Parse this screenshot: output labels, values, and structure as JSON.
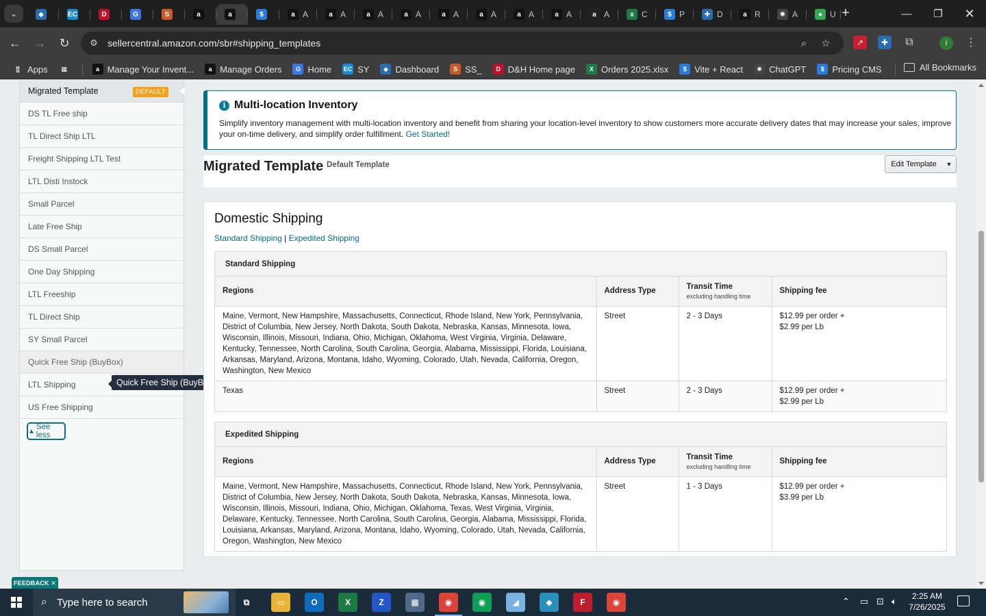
{
  "browser": {
    "tabs": [
      {
        "label": "",
        "icon": "blue-diamond",
        "color": "#2a6cb0",
        "glyph": "◆",
        "w": 46
      },
      {
        "label": "",
        "icon": "ec-logo",
        "color": "#1a8bd0",
        "glyph": "EC",
        "w": 46
      },
      {
        "label": "",
        "icon": "dh-logo",
        "color": "#c0102a",
        "glyph": "D",
        "w": 46
      },
      {
        "label": "",
        "icon": "g-docs",
        "color": "#3b78e7",
        "glyph": "G",
        "w": 46
      },
      {
        "label": "",
        "icon": "ss-logo",
        "color": "#c85a2a",
        "glyph": "S",
        "w": 46
      },
      {
        "label": "",
        "icon": "amazon-logo",
        "color": "#111111",
        "glyph": "a",
        "w": 46
      },
      {
        "label": "",
        "icon": "amazon-logo",
        "color": "#111111",
        "glyph": "a",
        "w": 46,
        "active": true
      },
      {
        "label": "",
        "icon": "dollar-logo",
        "color": "#2b7bd8",
        "glyph": "$",
        "w": 46
      },
      {
        "label": "A",
        "icon": "amazon-logo",
        "color": "#111111",
        "glyph": "a",
        "w": 55
      },
      {
        "label": "A",
        "icon": "amazon-logo",
        "color": "#111111",
        "glyph": "a",
        "w": 55
      },
      {
        "label": "A",
        "icon": "amazon-logo",
        "color": "#111111",
        "glyph": "a",
        "w": 55
      },
      {
        "label": "A",
        "icon": "amazon-logo",
        "color": "#111111",
        "glyph": "a",
        "w": 55
      },
      {
        "label": "A",
        "icon": "amazon-logo",
        "color": "#111111",
        "glyph": "a",
        "w": 55
      },
      {
        "label": "A",
        "icon": "amazon-logo",
        "color": "#111111",
        "glyph": "a",
        "w": 55
      },
      {
        "label": "A",
        "icon": "amazon-logo",
        "color": "#111111",
        "glyph": "a",
        "w": 55
      },
      {
        "label": "A",
        "icon": "amazon-logo",
        "color": "#111111",
        "glyph": "a",
        "w": 55
      },
      {
        "label": "A",
        "icon": "amazon-circle-logo",
        "color": "#222222",
        "glyph": "a",
        "w": 55
      },
      {
        "label": "C",
        "icon": "excel-circle-logo",
        "color": "#1d7a45",
        "glyph": "x",
        "w": 55
      },
      {
        "label": "P",
        "icon": "dollar-logo",
        "color": "#2b7bd8",
        "glyph": "$",
        "w": 55
      },
      {
        "label": "D",
        "icon": "blue-cross-logo",
        "color": "#2a6cb0",
        "glyph": "✚",
        "w": 55
      },
      {
        "label": "R",
        "icon": "amazon-logo",
        "color": "#111111",
        "glyph": "a",
        "w": 55
      },
      {
        "label": "A",
        "icon": "openai-logo",
        "color": "#444444",
        "glyph": "✺",
        "w": 55
      },
      {
        "label": "U",
        "icon": "maps-pin",
        "color": "#34a853",
        "glyph": "●",
        "w": 50
      }
    ],
    "url": "sellercentral.amazon.com/sbr#shipping_templates",
    "bookmarks": [
      {
        "label": "Apps",
        "icon": "apps-grid-icon",
        "color": "#3c3c3c",
        "glyph": "⣿"
      },
      {
        "label": "",
        "icon": "apps-grid-icon",
        "color": "#3c3c3c",
        "glyph": "▦"
      },
      {
        "label": "Manage Your Invent...",
        "icon": "amazon-logo",
        "color": "#111111",
        "glyph": "a"
      },
      {
        "label": "Manage Orders",
        "icon": "amazon-logo",
        "color": "#111111",
        "glyph": "a"
      },
      {
        "label": "Home",
        "icon": "g-docs",
        "color": "#3b78e7",
        "glyph": "G"
      },
      {
        "label": "SY",
        "icon": "ec-logo",
        "color": "#1a8bd0",
        "glyph": "EC"
      },
      {
        "label": "Dashboard",
        "icon": "blue-diamond",
        "color": "#2a6cb0",
        "glyph": "◆"
      },
      {
        "label": "SS_",
        "icon": "ss-logo",
        "color": "#c85a2a",
        "glyph": "S"
      },
      {
        "label": "D&H Home page",
        "icon": "dh-logo",
        "color": "#c0102a",
        "glyph": "D"
      },
      {
        "label": "Orders 2025.xlsx",
        "icon": "excel-logo",
        "color": "#1d7a45",
        "glyph": "X"
      },
      {
        "label": "Vite + React",
        "icon": "dollar-logo",
        "color": "#2b7bd8",
        "glyph": "$"
      },
      {
        "label": "ChatGPT",
        "icon": "openai-logo",
        "color": "#444444",
        "glyph": "✺"
      },
      {
        "label": "Pricing CMS",
        "icon": "dollar-logo",
        "color": "#2b7bd8",
        "glyph": "$"
      }
    ],
    "all_bookmarks": "All Bookmarks"
  },
  "sidebar": {
    "templates": [
      {
        "name": "Migrated Template",
        "badge": "DEFAULT",
        "state": "selected"
      },
      {
        "name": "DS TL Free ship"
      },
      {
        "name": "TL Direct Ship LTL"
      },
      {
        "name": "Freight Shipping LTL Test"
      },
      {
        "name": "LTL Disti Instock"
      },
      {
        "name": "Small Parcel"
      },
      {
        "name": "Late Free Ship"
      },
      {
        "name": "DS Small Parcel"
      },
      {
        "name": "One Day Shipping"
      },
      {
        "name": "LTL Freeship"
      },
      {
        "name": "TL Direct Ship"
      },
      {
        "name": "SY Small Parcel"
      },
      {
        "name": "Quick Free Ship (BuyBox)",
        "state": "hover"
      },
      {
        "name": "LTL Shipping"
      },
      {
        "name": "US Free Shipping"
      }
    ],
    "see_less": "See less",
    "tooltip": "Quick Free Ship (BuyBox)"
  },
  "alert": {
    "title": "Multi-location Inventory",
    "body": "Simplify inventory management with multi-location inventory and benefit from sharing your location-level inventory to show customers more accurate delivery dates that may increase your sales, improve your on-time delivery, and simplify order fulfillment.",
    "link": "Get Started!"
  },
  "template": {
    "title": "Migrated Template",
    "subtitle": "Default Template",
    "edit_button": "Edit Template"
  },
  "domestic": {
    "title": "Domestic Shipping",
    "link_standard": "Standard Shipping",
    "link_separator": "|",
    "link_expedited": "Expedited Shipping",
    "columns": {
      "regions": "Regions",
      "address_type": "Address Type",
      "transit_time": "Transit Time",
      "transit_sub": "excluding handling time",
      "shipping_fee": "Shipping fee"
    },
    "standard": {
      "title": "Standard Shipping",
      "rows": [
        {
          "regions": "Maine, Vermont, New Hampshire, Massachusetts, Connecticut, Rhode Island, New York, Pennsylvania, District of Columbia, New Jersey, North Dakota, South Dakota, Nebraska, Kansas, Minnesota, Iowa, Wisconsin, Illinois, Missouri, Indiana, Ohio, Michigan, Oklahoma, West Virginia, Virginia, Delaware, Kentucky, Tennessee, North Carolina, South Carolina, Georgia, Alabama, Mississippi, Florida, Louisiana, Arkansas, Maryland, Arizona, Montana, Idaho, Wyoming, Colorado, Utah, Nevada, California, Oregon, Washington, New Mexico",
          "address_type": "Street",
          "transit": "2 - 3 Days",
          "fee_line1": "$12.99 per order +",
          "fee_line2": "$2.99 per Lb"
        },
        {
          "regions": "Texas",
          "address_type": "Street",
          "transit": "2 - 3 Days",
          "fee_line1": "$12.99 per order +",
          "fee_line2": "$2.99 per Lb"
        }
      ]
    },
    "expedited": {
      "title": "Expedited Shipping",
      "rows": [
        {
          "regions": "Maine, Vermont, New Hampshire, Massachusetts, Connecticut, Rhode Island, New York, Pennsylvania, District of Columbia, New Jersey, North Dakota, South Dakota, Nebraska, Kansas, Minnesota, Iowa, Wisconsin, Illinois, Missouri, Indiana, Ohio, Michigan, Oklahoma, Texas, West Virginia, Virginia, Delaware, Kentucky, Tennessee, North Carolina, South Carolina, Georgia, Alabama, Mississippi, Florida, Louisiana, Arkansas, Maryland, Arizona, Montana, Idaho, Wyoming, Colorado, Utah, Nevada, California, Oregon, Washington, New Mexico",
          "address_type": "Street",
          "transit": "1 - 3 Days",
          "fee_line1": "$12.99 per order +",
          "fee_line2": "$3.99 per Lb"
        }
      ]
    }
  },
  "feedback": "FEEDBACK ✕",
  "taskbar": {
    "search_placeholder": "Type here to search",
    "apps": [
      {
        "name": "task-view",
        "color": "#1c2b3a",
        "glyph": "⧉"
      },
      {
        "name": "file-explorer",
        "color": "#e8b339",
        "glyph": "▭"
      },
      {
        "name": "outlook",
        "color": "#0f6cbd",
        "glyph": "O"
      },
      {
        "name": "excel",
        "color": "#1d7a45",
        "glyph": "X"
      },
      {
        "name": "zoho",
        "color": "#2457c5",
        "glyph": "Z"
      },
      {
        "name": "calculator",
        "color": "#4f6a86",
        "glyph": "▦"
      },
      {
        "name": "chrome",
        "color": "#db4437",
        "glyph": "◉",
        "active": true
      },
      {
        "name": "chrome-2",
        "color": "#0f9d58",
        "glyph": "◉"
      },
      {
        "name": "paper-app",
        "color": "#78b3e0",
        "glyph": "◢"
      },
      {
        "name": "blue-diamond-app",
        "color": "#2a8fb8",
        "glyph": "◆"
      },
      {
        "name": "filezilla",
        "color": "#bf1e2e",
        "glyph": "F"
      },
      {
        "name": "chrome-3",
        "color": "#db4437",
        "glyph": "◉"
      }
    ],
    "time": "2:25 AM",
    "date": "7/26/2025"
  }
}
